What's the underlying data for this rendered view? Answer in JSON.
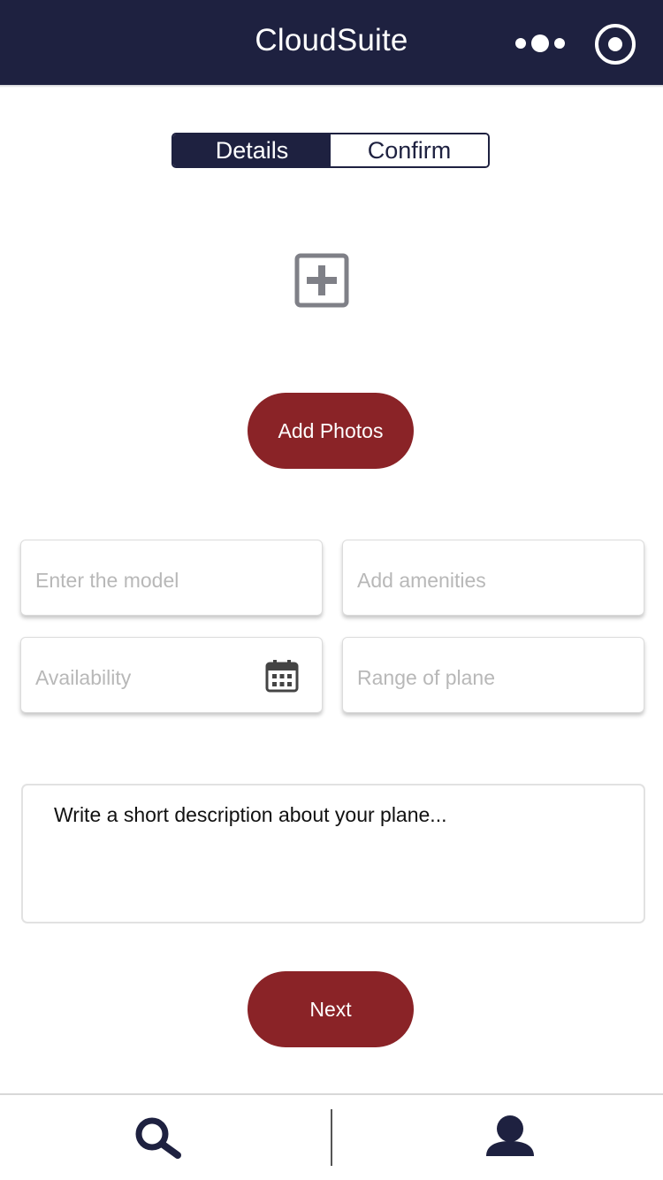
{
  "header": {
    "title": "CloudSuite",
    "background_color": "#1e2140",
    "more_icon": "more-dots-icon",
    "record_icon": "record-circle-icon"
  },
  "tabs": [
    {
      "label": "Details",
      "active": true
    },
    {
      "label": "Confirm",
      "active": false
    }
  ],
  "photo_section": {
    "add_icon": "add-box-icon",
    "add_photos_label": "Add Photos"
  },
  "form": {
    "model_placeholder": "Enter the model",
    "amenities_placeholder": "Add amenities",
    "availability_placeholder": "Availability",
    "calendar_icon": "calendar-icon",
    "range_placeholder": "Range of plane",
    "description_placeholder": "Write a short description about your plane..."
  },
  "actions": {
    "next_label": "Next",
    "accent_color": "#8a2327"
  },
  "bottom_nav": {
    "items": [
      {
        "icon": "search-icon"
      },
      {
        "icon": "user-icon"
      }
    ]
  }
}
